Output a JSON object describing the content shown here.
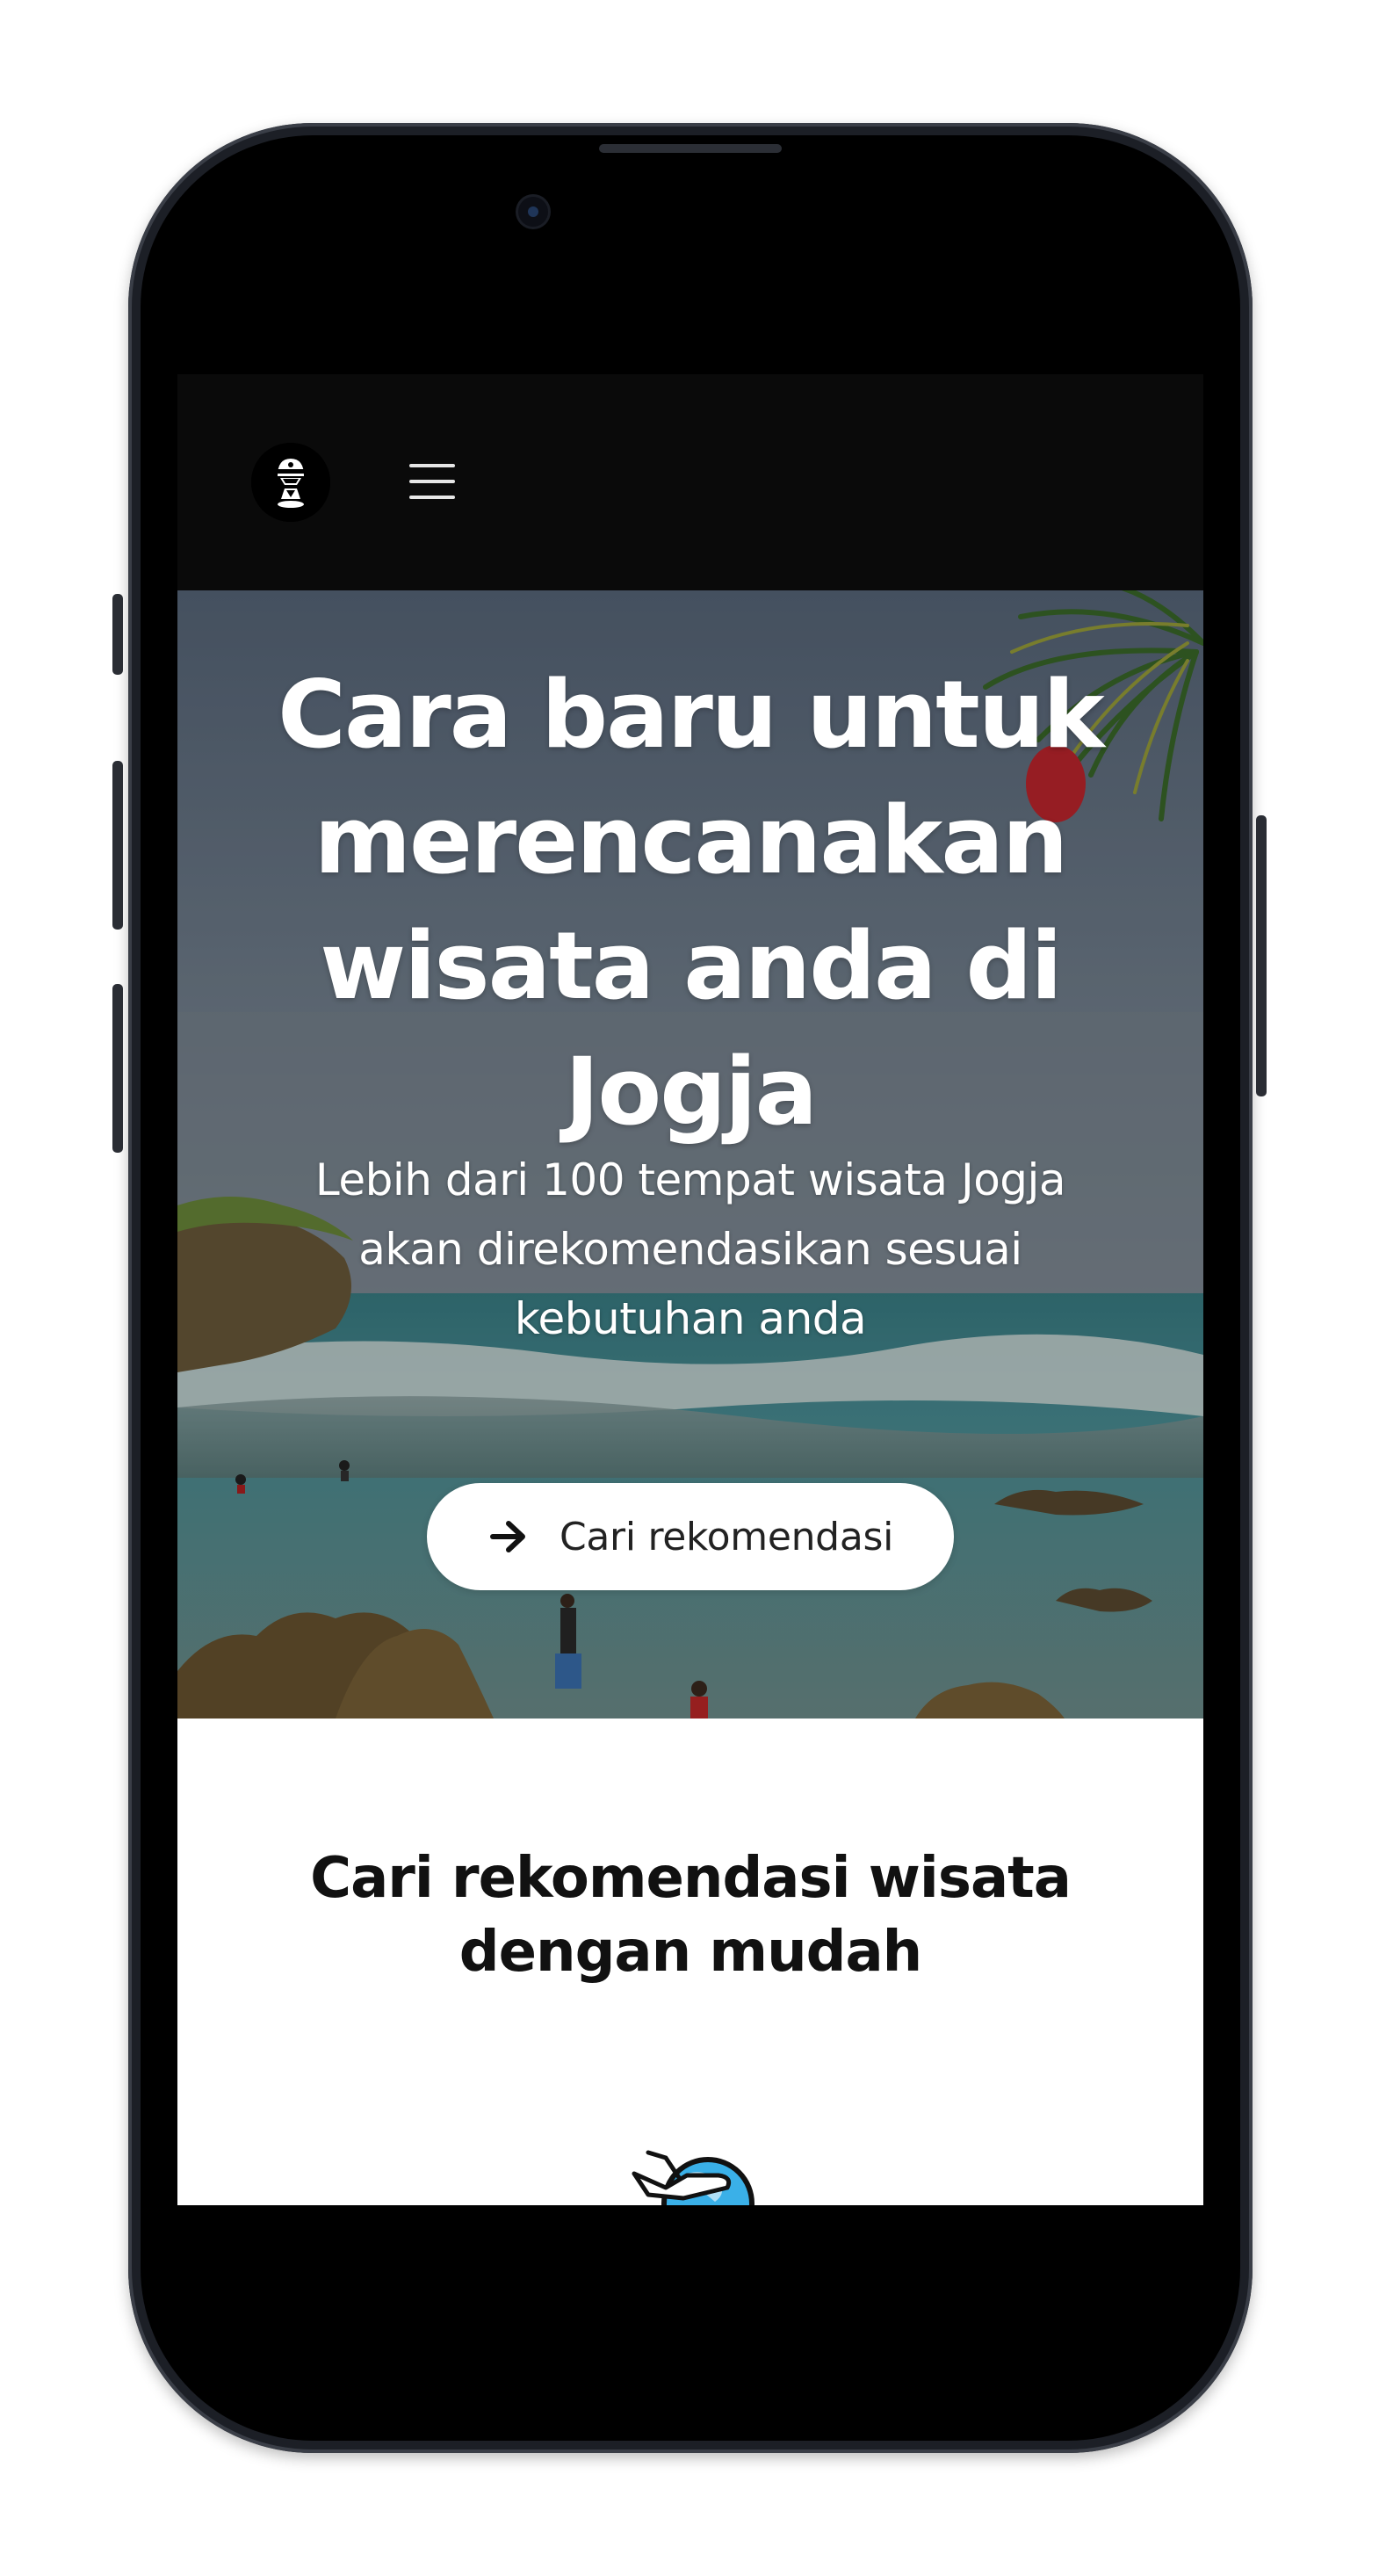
{
  "navbar": {
    "logo_icon": "explorer-logo-icon",
    "menu_icon": "hamburger-menu-icon"
  },
  "hero": {
    "title": "Cara baru untuk merencanakan wisata anda di Jogja",
    "subtitle": "Lebih dari 100 tempat wisata Jogja akan direkomendasikan sesuai kebutuhan anda",
    "cta_label": "Cari rekomendasi",
    "cta_icon": "arrow-right-icon",
    "background": "beach-photo"
  },
  "section": {
    "title": "Cari rekomendasi wisata dengan mudah",
    "illustration_icon": "airplane-globe-icon"
  },
  "colors": {
    "navbar_bg": "#0a0a0a",
    "button_bg": "#ffffff",
    "text_dark": "#111111"
  }
}
